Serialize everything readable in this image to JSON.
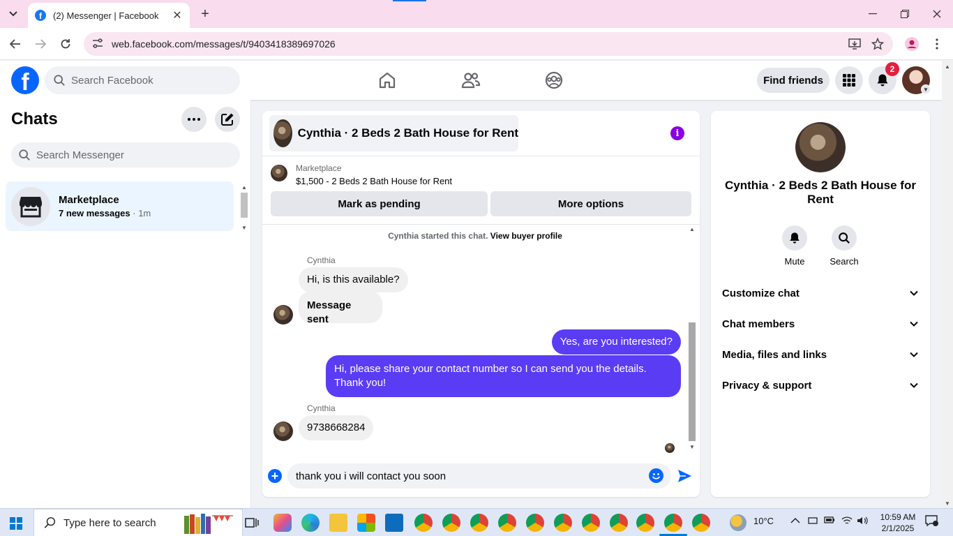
{
  "browser": {
    "tab_title": "(2) Messenger | Facebook",
    "url": "web.facebook.com/messages/t/9403418389697026"
  },
  "fb_header": {
    "search_placeholder": "Search Facebook",
    "find_friends_label": "Find friends",
    "notification_count": "2"
  },
  "chats": {
    "title": "Chats",
    "search_placeholder": "Search Messenger",
    "items": [
      {
        "name": "Marketplace",
        "preview": "7 new messages",
        "time": "1m"
      }
    ]
  },
  "conversation": {
    "title": "Cynthia · 2 Beds 2 Bath House for Rent",
    "listing_label": "Marketplace",
    "listing_title": "$1,500 - 2 Beds 2 Bath House for Rent",
    "mark_pending_label": "Mark as pending",
    "more_options_label": "More options",
    "started_text": "Cynthia started this chat.",
    "view_buyer_profile": "View buyer profile",
    "messages": [
      {
        "sender": "Cynthia",
        "text": "Hi, is this available?",
        "direction": "in"
      },
      {
        "text": "Message sent",
        "direction": "in"
      },
      {
        "text": "Yes, are you interested?",
        "direction": "out"
      },
      {
        "text": "Hi, please share your contact number so I can send you the details. Thank you!",
        "direction": "out"
      },
      {
        "sender": "Cynthia",
        "text": "9738668284",
        "direction": "in"
      }
    ],
    "composer_value": "thank you i will contact you soon"
  },
  "info_panel": {
    "name": "Cynthia · 2 Beds 2 Bath House for Rent",
    "actions": [
      "Mute",
      "Search"
    ],
    "sections": [
      "Customize chat",
      "Chat members",
      "Media, files and links",
      "Privacy & support"
    ]
  },
  "taskbar": {
    "search_placeholder": "Type here to search",
    "temperature": "10°C",
    "time": "10:59 AM",
    "date": "2/1/2025"
  },
  "colors": {
    "fb_blue": "#0866ff",
    "outgoing_bubble": "#5b3cf5",
    "info_purple": "#8a00e6",
    "badge_red": "#e41e3f",
    "chat_selected_bg": "#ebf5ff"
  },
  "icons": [
    "chevron-down-icon",
    "facebook-favicon",
    "close-icon",
    "plus-icon",
    "minimize-icon",
    "restore-icon",
    "back-icon",
    "forward-icon",
    "reload-icon",
    "site-settings-icon",
    "install-icon",
    "star-icon",
    "profile-icon",
    "menu-dots-icon",
    "facebook-logo",
    "search-icon",
    "home-icon",
    "friends-icon",
    "groups-icon",
    "apps-grid-icon",
    "bell-icon",
    "more-dots-icon",
    "compose-icon",
    "store-icon",
    "info-icon",
    "add-icon",
    "emoji-icon",
    "send-icon",
    "windows-start-icon"
  ]
}
